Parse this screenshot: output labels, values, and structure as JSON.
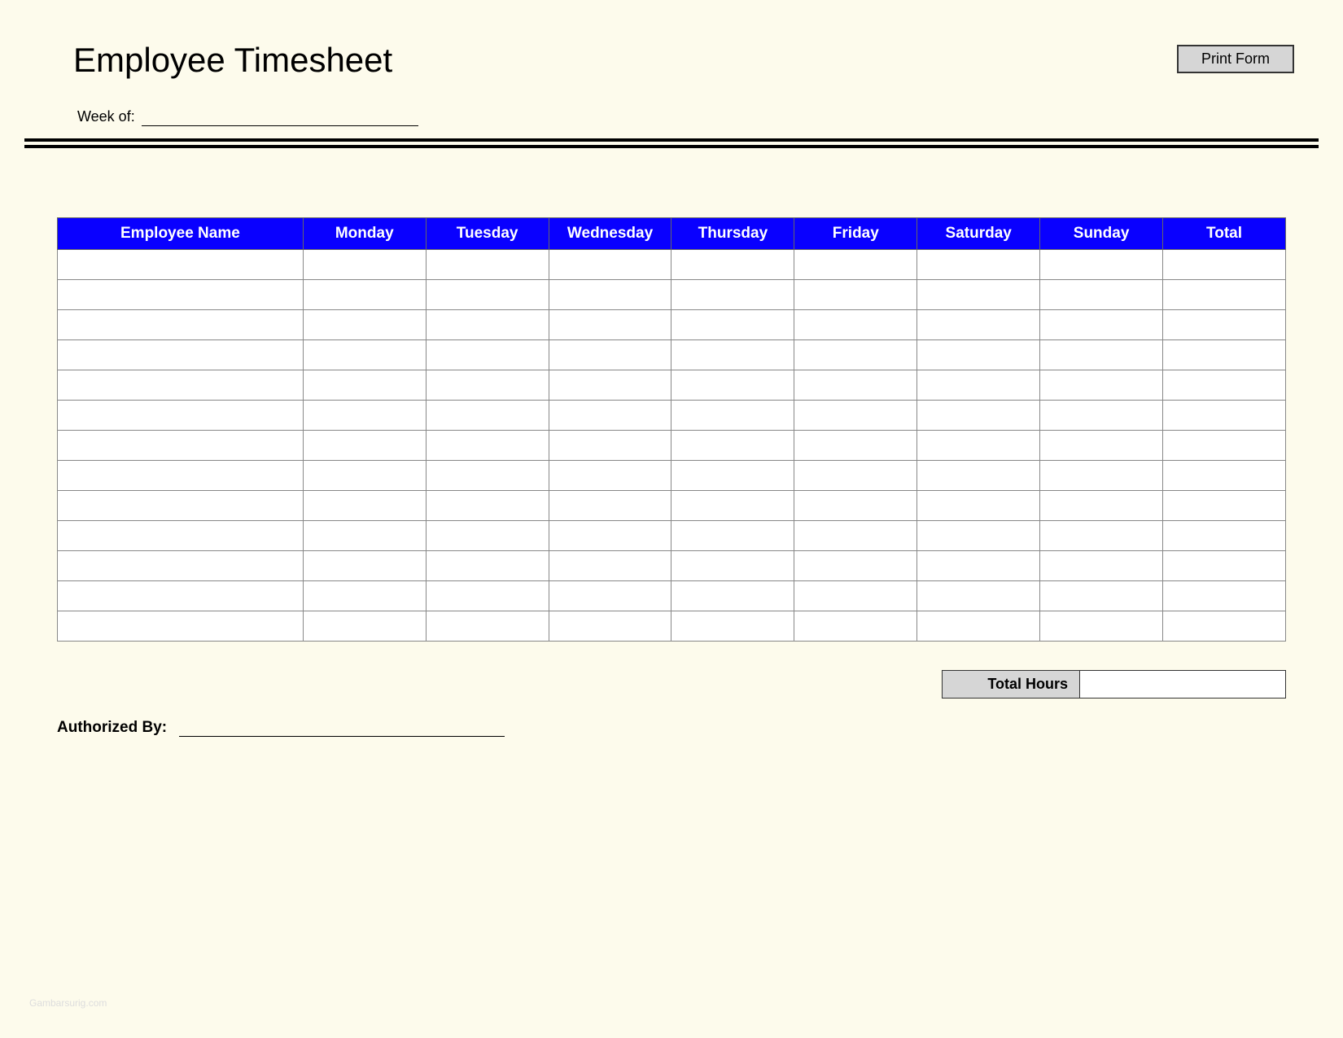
{
  "title": "Employee Timesheet",
  "print_button_label": "Print Form",
  "week_label": "Week of:",
  "week_value": "",
  "columns": [
    "Employee Name",
    "Monday",
    "Tuesday",
    "Wednesday",
    "Thursday",
    "Friday",
    "Saturday",
    "Sunday",
    "Total"
  ],
  "rows": [
    [
      "",
      "",
      "",
      "",
      "",
      "",
      "",
      "",
      ""
    ],
    [
      "",
      "",
      "",
      "",
      "",
      "",
      "",
      "",
      ""
    ],
    [
      "",
      "",
      "",
      "",
      "",
      "",
      "",
      "",
      ""
    ],
    [
      "",
      "",
      "",
      "",
      "",
      "",
      "",
      "",
      ""
    ],
    [
      "",
      "",
      "",
      "",
      "",
      "",
      "",
      "",
      ""
    ],
    [
      "",
      "",
      "",
      "",
      "",
      "",
      "",
      "",
      ""
    ],
    [
      "",
      "",
      "",
      "",
      "",
      "",
      "",
      "",
      ""
    ],
    [
      "",
      "",
      "",
      "",
      "",
      "",
      "",
      "",
      ""
    ],
    [
      "",
      "",
      "",
      "",
      "",
      "",
      "",
      "",
      ""
    ],
    [
      "",
      "",
      "",
      "",
      "",
      "",
      "",
      "",
      ""
    ],
    [
      "",
      "",
      "",
      "",
      "",
      "",
      "",
      "",
      ""
    ],
    [
      "",
      "",
      "",
      "",
      "",
      "",
      "",
      "",
      ""
    ],
    [
      "",
      "",
      "",
      "",
      "",
      "",
      "",
      "",
      ""
    ]
  ],
  "total_hours_label": "Total Hours",
  "total_hours_value": "",
  "authorized_label": "Authorized By:",
  "authorized_value": "",
  "watermark": "Gambarsurig.com"
}
